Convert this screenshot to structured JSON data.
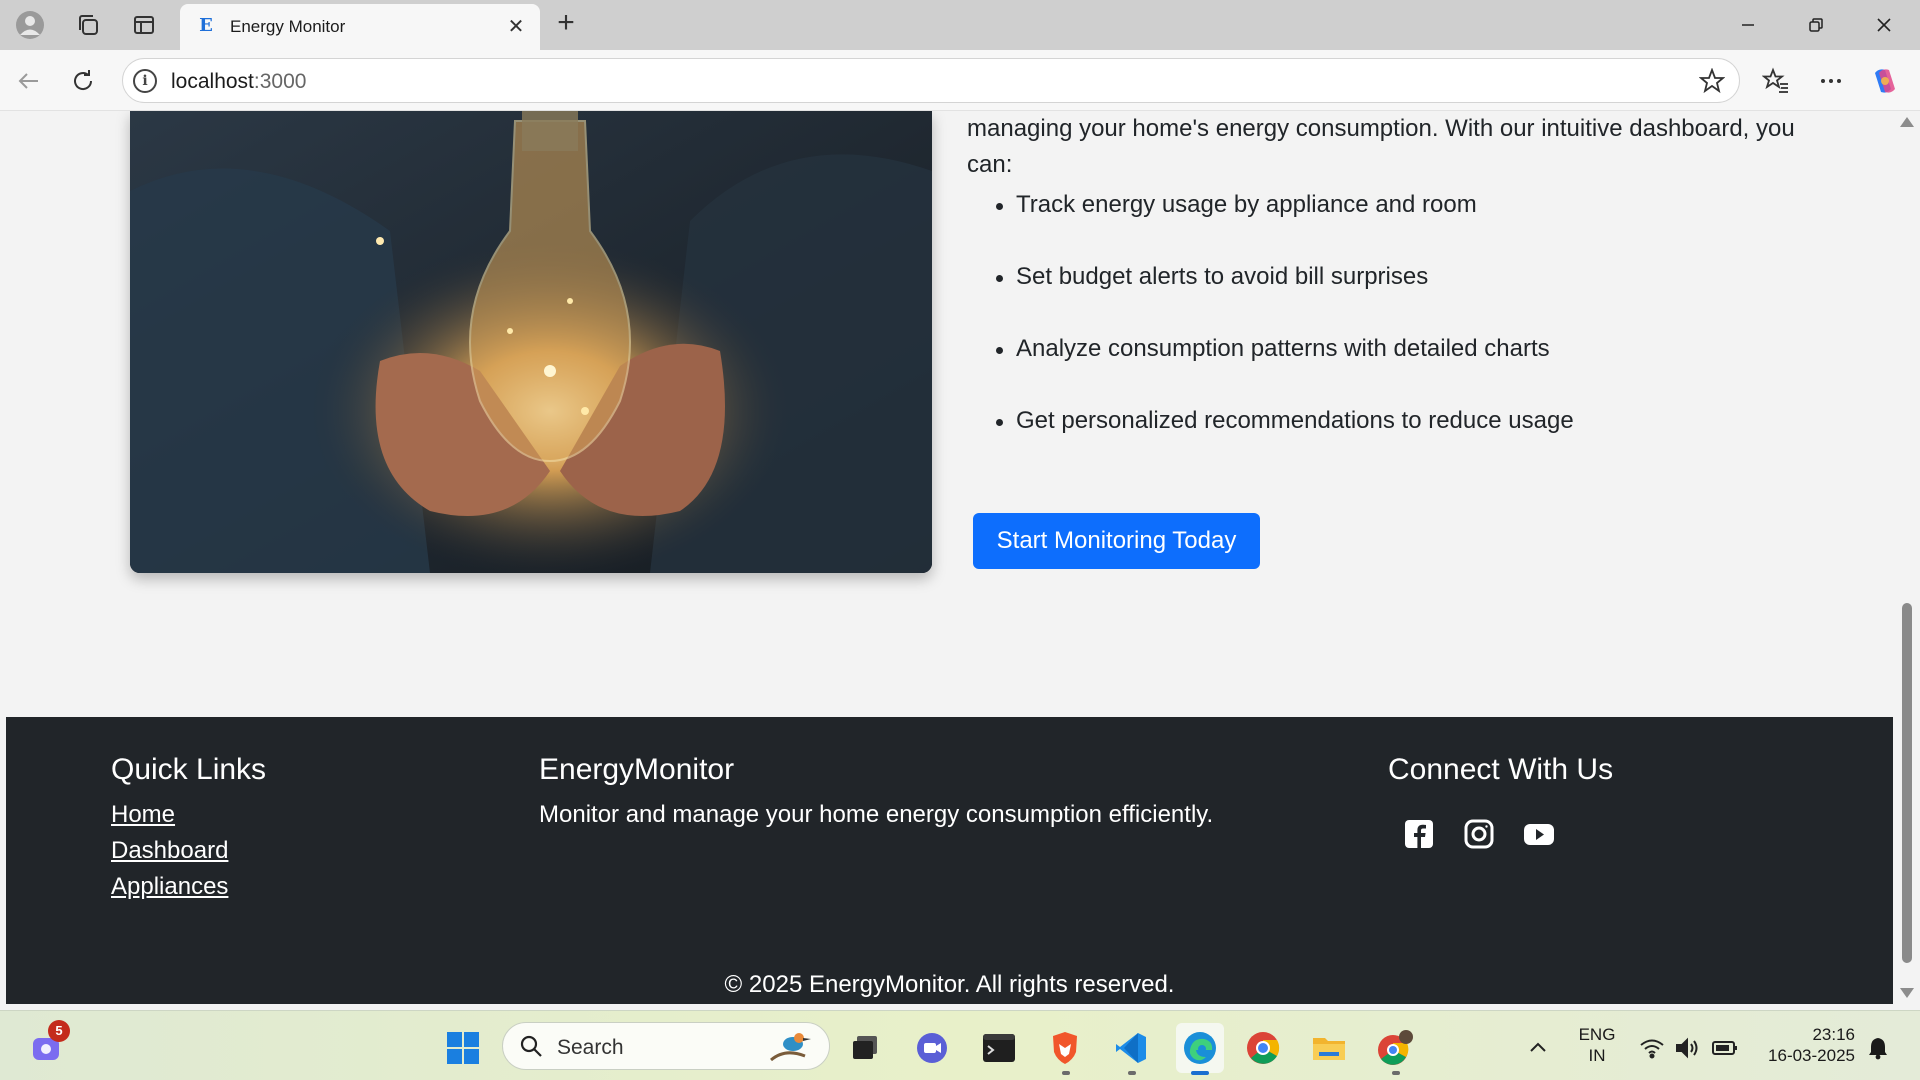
{
  "browser": {
    "tab_title": "Energy Monitor",
    "tab_favicon": "E",
    "address_host": "localhost",
    "address_port": ":3000"
  },
  "about": {
    "intro_text": "managing your home's energy consumption. With our intuitive dashboard, you can:",
    "features": [
      "Track energy usage by appliance and room",
      "Set budget alerts to avoid bill surprises",
      "Analyze consumption patterns with detailed charts",
      "Get personalized recommendations to reduce usage"
    ],
    "cta_label": "Start Monitoring Today",
    "cta_color": "#0d6efd",
    "image_icon": "hands-holding-lightbulb-photo"
  },
  "footer": {
    "quick_links_title": "Quick Links",
    "links": [
      "Home",
      "Dashboard",
      "Appliances"
    ],
    "brand_title": "EnergyMonitor",
    "brand_description": "Monitor and manage your home energy consumption efficiently.",
    "connect_title": "Connect With Us",
    "socials": [
      "facebook-icon",
      "instagram-icon",
      "youtube-icon"
    ],
    "copyright": "© 2025 EnergyMonitor. All rights reserved.",
    "background": "#212529"
  },
  "taskbar": {
    "search_placeholder": "Search",
    "teams_badge": "5",
    "language_line1": "ENG",
    "language_line2": "IN",
    "time": "23:16",
    "date": "16-03-2025"
  }
}
